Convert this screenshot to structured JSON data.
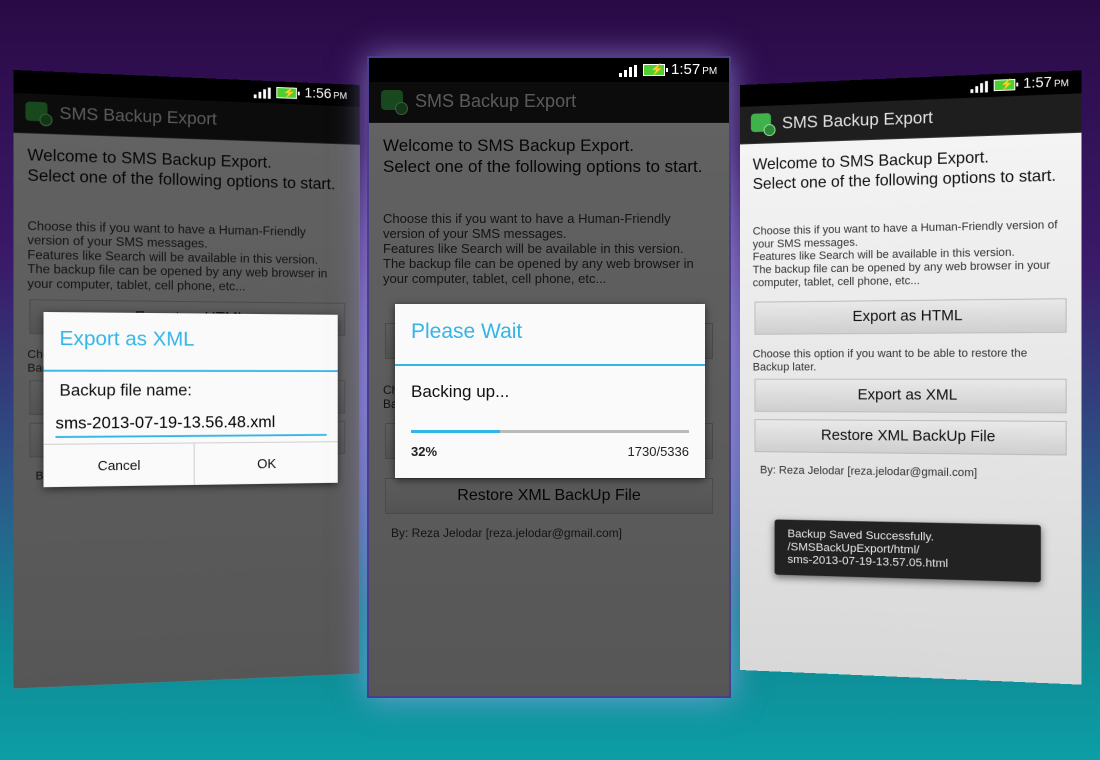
{
  "app": {
    "title": "SMS Backup Export"
  },
  "main": {
    "welcome": "Welcome to SMS Backup Export.\n Select one of the following options to start.",
    "html_desc": "Choose this if you want to have a Human-Friendly version of your SMS messages.\nFeatures like Search will be available in this version.\nThe backup file can be opened by any web browser in your computer, tablet, cell phone, etc...",
    "export_html_label": "Export as HTML",
    "xml_desc": "Choose this option if you want to be able to restore the Backup later.",
    "export_xml_label": "Export as XML",
    "restore_label": "Restore XML BackUp File",
    "byline": "By: Reza Jelodar [reza.jelodar@gmail.com]"
  },
  "phones": {
    "left": {
      "time": "1:56",
      "ampm": "PM",
      "dialog": {
        "title": "Export as XML",
        "field_label": "Backup file name:",
        "filename": "sms-2013-07-19-13.56.48.xml",
        "cancel": "Cancel",
        "ok": "OK"
      }
    },
    "center": {
      "time": "1:57",
      "ampm": "PM",
      "dialog": {
        "title": "Please Wait",
        "message": "Backing up...",
        "progress": 0.32,
        "percent_label": "32%",
        "count_label": "1730/5336"
      }
    },
    "right": {
      "time": "1:57",
      "ampm": "PM",
      "toast": "Backup Saved Successfully.\n/SMSBackUpExport/html/\nsms-2013-07-19-13.57.05.html"
    }
  },
  "colors": {
    "accent": "#33b5e5",
    "battery": "#4fcf2f",
    "app_icon": "#3fb24b"
  },
  "icons": [
    "signal-icon",
    "battery-icon",
    "app-icon"
  ]
}
